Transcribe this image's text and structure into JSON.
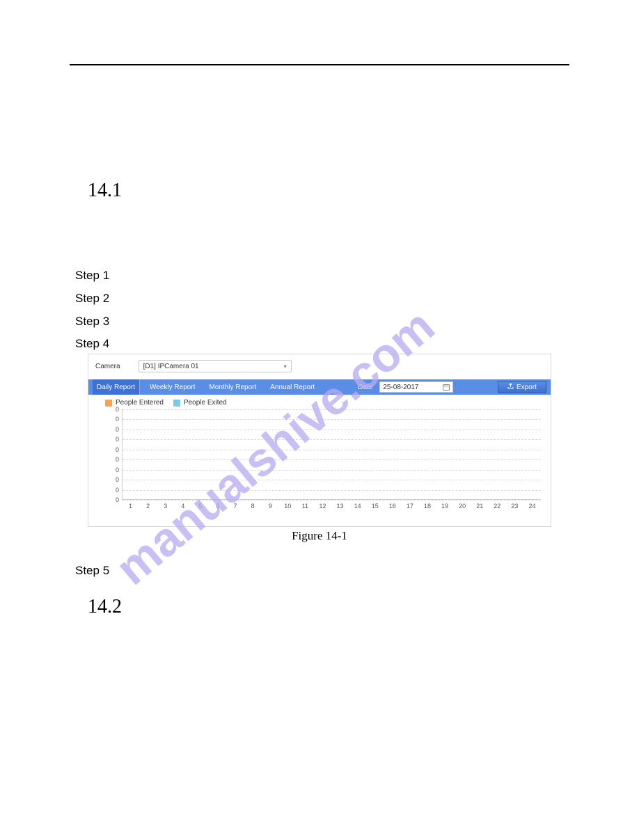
{
  "sections": {
    "s14_1": "14.1",
    "s14_2": "14.2"
  },
  "steps": {
    "s1": "Step 1",
    "s2": "Step 2",
    "s3": "Step 3",
    "s4": "Step 4",
    "s5": "Step 5"
  },
  "figure_caption": "Figure 14-1",
  "app": {
    "camera_label": "Camera",
    "camera_value": "[D1] IPCamera 01",
    "tabs": {
      "daily": "Daily Report",
      "weekly": "Weekly Report",
      "monthly": "Monthly Report",
      "annual": "Annual Report"
    },
    "date_label": "Date",
    "date_value": "25-08-2017",
    "export_label": "Export",
    "legend": {
      "entered": "People Entered",
      "exited": "People Exited",
      "entered_color": "#f5a25a",
      "exited_color": "#7fc9e8"
    }
  },
  "chart_data": {
    "type": "bar",
    "title": "",
    "xlabel": "",
    "ylabel": "",
    "ylim": [
      0,
      0
    ],
    "categories": [
      "1",
      "2",
      "3",
      "4",
      "5",
      "6",
      "7",
      "8",
      "9",
      "10",
      "11",
      "12",
      "13",
      "14",
      "15",
      "16",
      "17",
      "18",
      "19",
      "20",
      "21",
      "22",
      "23",
      "24"
    ],
    "y_ticks": [
      "0",
      "0",
      "0",
      "0",
      "0",
      "0",
      "0",
      "0",
      "0",
      "0"
    ],
    "series": [
      {
        "name": "People Entered",
        "values": [
          0,
          0,
          0,
          0,
          0,
          0,
          0,
          0,
          0,
          0,
          0,
          0,
          0,
          0,
          0,
          0,
          0,
          0,
          0,
          0,
          0,
          0,
          0,
          0
        ]
      },
      {
        "name": "People Exited",
        "values": [
          0,
          0,
          0,
          0,
          0,
          0,
          0,
          0,
          0,
          0,
          0,
          0,
          0,
          0,
          0,
          0,
          0,
          0,
          0,
          0,
          0,
          0,
          0,
          0
        ]
      }
    ]
  },
  "watermark": "manualshive.com"
}
